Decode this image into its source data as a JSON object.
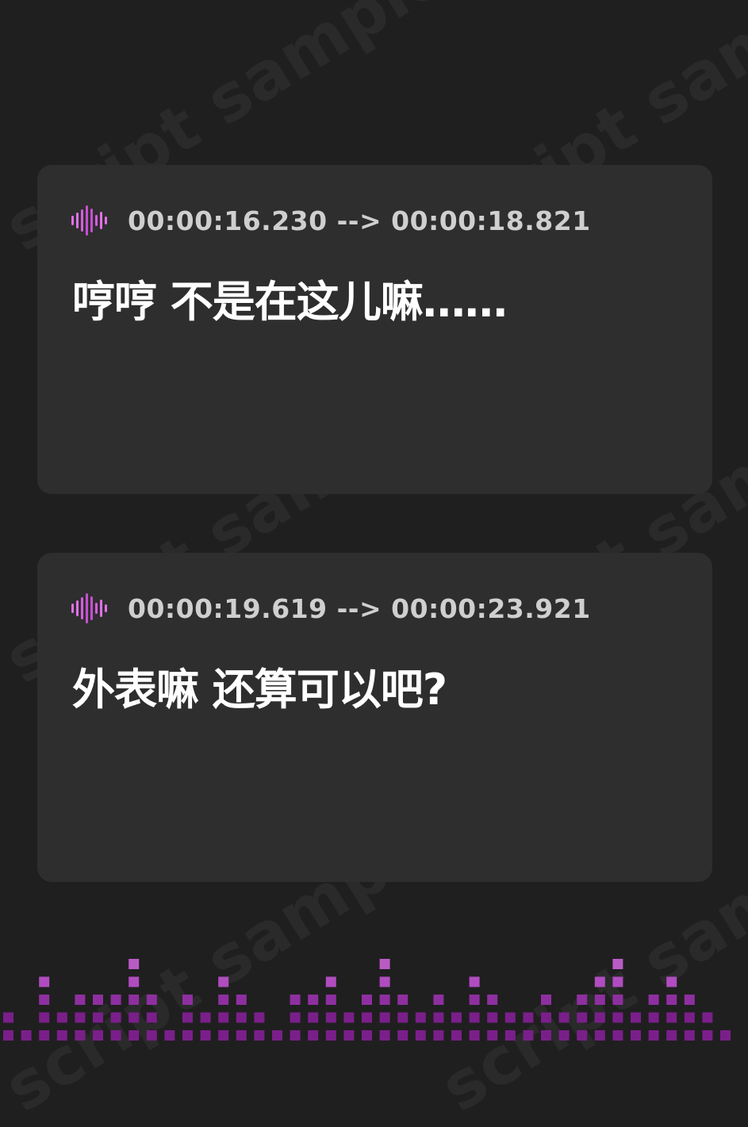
{
  "watermark": {
    "text": "script sample"
  },
  "cards": [
    {
      "icon": "audio-wave-icon",
      "timestamp": "00:00:16.230 --> 00:00:18.821",
      "text": "哼哼 不是在这儿嘛……"
    },
    {
      "icon": "audio-wave-icon",
      "timestamp": "00:00:19.619 --> 00:00:23.921",
      "text": "外表嘛 还算可以吧?"
    }
  ],
  "colors": {
    "background": "#1f1f1f",
    "card": "#2e2e2e",
    "timestamp": "#cfcfcf",
    "subtitle": "#ffffff",
    "accent_light": "#e070e8",
    "accent_mid": "#b04cc0",
    "accent_dark": "#7a1f8a"
  },
  "equalizer": {
    "icon": "equalizer-bars-icon",
    "levels": [
      2,
      1,
      4,
      2,
      3,
      3,
      3,
      5,
      3,
      1,
      3,
      2,
      4,
      3,
      2,
      1,
      3,
      3,
      4,
      2,
      3,
      5,
      3,
      2,
      3,
      2,
      4,
      3,
      2,
      2,
      3,
      2,
      3,
      4,
      5,
      2,
      3,
      4,
      3,
      2,
      1,
      2
    ]
  }
}
